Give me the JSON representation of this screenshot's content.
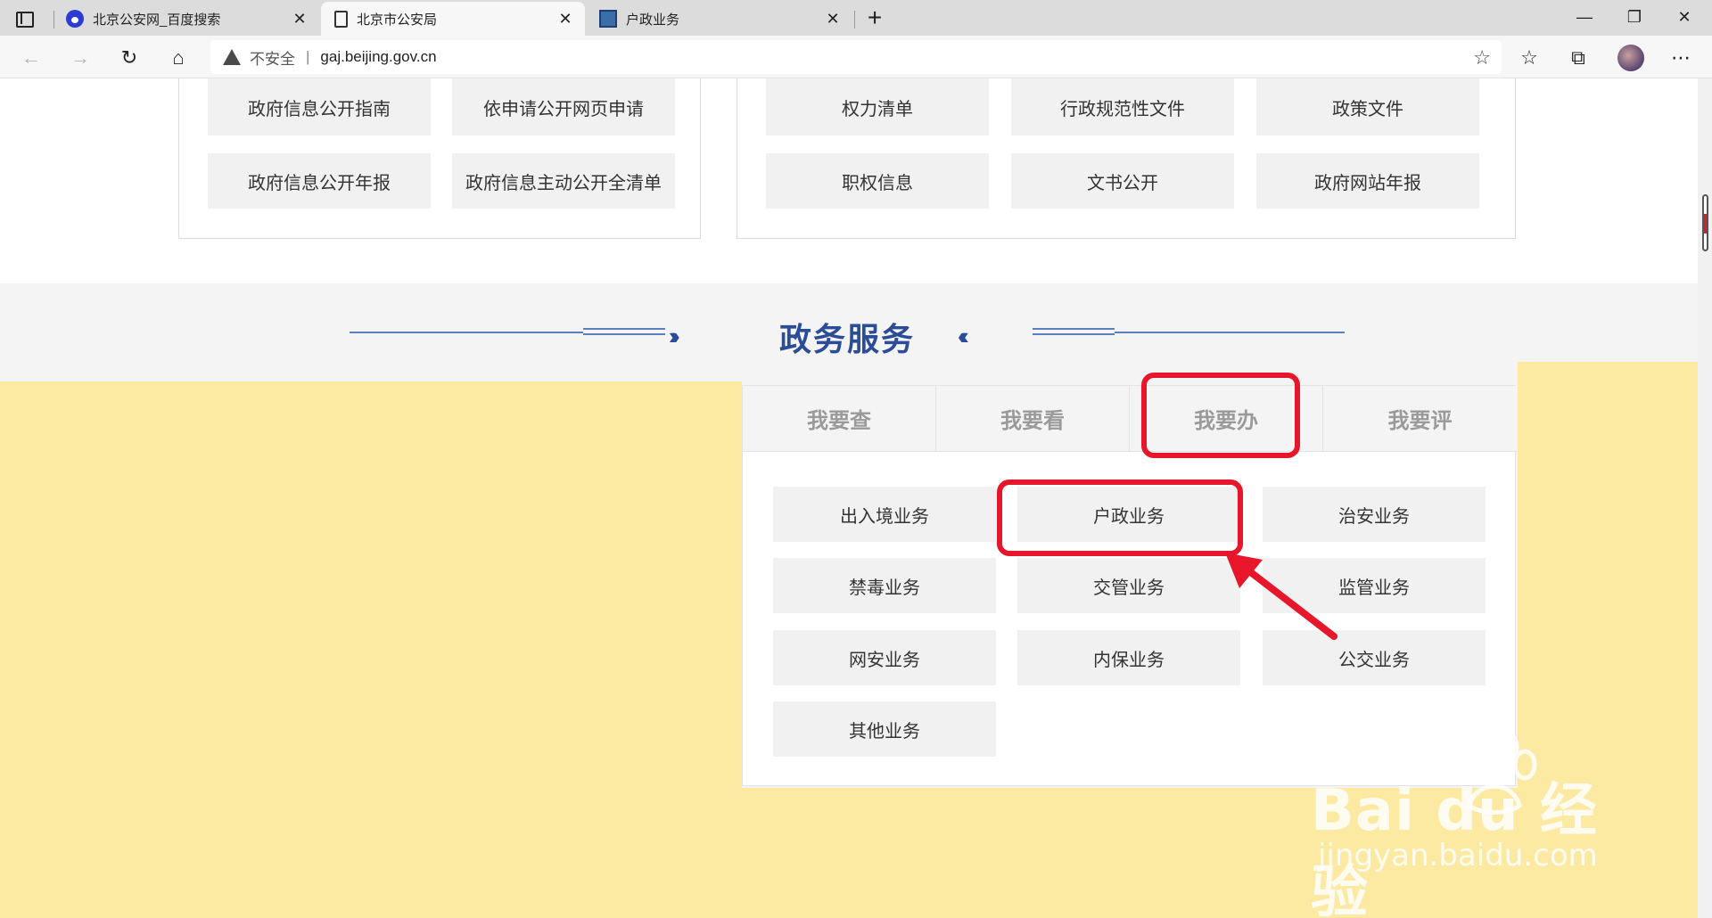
{
  "browser": {
    "tabs": [
      {
        "title": "北京公安网_百度搜索",
        "icon": "baidu-paw-icon",
        "active": false
      },
      {
        "title": "北京市公安局",
        "icon": "page-icon",
        "active": true
      },
      {
        "title": "户政业务",
        "icon": "site-icon",
        "active": false
      }
    ],
    "new_tab": "+",
    "window": {
      "minimize": "—",
      "restore": "❐",
      "close": "✕"
    },
    "security_label": "不安全",
    "url_separator": "|",
    "url": "gaj.beijing.gov.cn"
  },
  "top_left_panel": {
    "buttons": [
      "政府信息公开指南",
      "依申请公开网页申请",
      "政府信息公开年报",
      "政府信息主动公开全清单"
    ]
  },
  "top_right_panel": {
    "buttons": [
      "权力清单",
      "行政规范性文件",
      "政策文件",
      "职权信息",
      "文书公开",
      "政府网站年报"
    ]
  },
  "section": {
    "title": "政务服务",
    "left_arrows": "›››››››",
    "right_arrows": "‹‹‹‹‹‹‹"
  },
  "service_tabs": [
    "我要查",
    "我要看",
    "我要办",
    "我要评"
  ],
  "services": [
    "出入境业务",
    "户政业务",
    "治安业务",
    "禁毒业务",
    "交管业务",
    "监管业务",
    "网安业务",
    "内保业务",
    "公交业务",
    "其他业务"
  ],
  "annotation": {
    "highlight_color": "#e8162a",
    "highlighted_tab": "我要办",
    "highlighted_service": "户政业务"
  },
  "watermark": {
    "main": "Bai du 经验",
    "sub": "jingyan.baidu.com"
  },
  "colors": {
    "accent": "#2b4c96",
    "highlight_yellow": "#fce9a2"
  }
}
